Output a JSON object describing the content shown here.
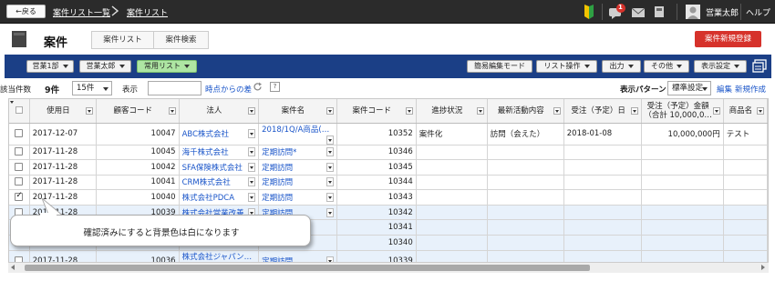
{
  "topbar": {
    "back_label": "←戻る",
    "crumb1": "案件リスト一覧",
    "crumb2": "案件リスト",
    "notification_count": "1",
    "user_name": "営業太郎",
    "help_label": "ヘルプ"
  },
  "title": {
    "page_title": "案件",
    "tab_list": "案件リスト",
    "tab_search": "案件検索",
    "new_button": "案件新規登録"
  },
  "toolbar": {
    "dept": "営業1部",
    "person": "営業太郎",
    "common_list": "常用リスト",
    "easy_edit": "簡易編集モード",
    "list_ops": "リスト操作",
    "output": "出力",
    "other": "その他",
    "display_settings": "表示設定"
  },
  "filter": {
    "count_label": "該当件数",
    "count_value": "9件",
    "per_page": "15件",
    "display_label": "表示",
    "diff_link": "時点からの差",
    "help_q": "?",
    "pattern_label": "表示パターン",
    "pattern_value": "標準設定",
    "edit_link": "編集",
    "new_link": "新規作成"
  },
  "columns": [
    "使用日",
    "顧客コード",
    "法人",
    "案件名",
    "案件コード",
    "進捗状況",
    "最新活動内容",
    "受注（予定）日",
    "受注（予定）金額\n（合計 10,000,0…",
    "商品名"
  ],
  "rows": [
    {
      "checked": false,
      "confirmed": true,
      "date": "2017-12-07",
      "cust_code": "10047",
      "corp": "ABC株式会社",
      "deal": "2018/1Q/A商品(…",
      "deal_code": "10352",
      "progress": "案件化",
      "activity": "訪問（会えた）",
      "order_date": "2018-01-08",
      "amount": "10,000,000円",
      "product": "テスト"
    },
    {
      "checked": false,
      "confirmed": true,
      "date": "2017-11-28",
      "cust_code": "10045",
      "corp": "海千株式会社",
      "deal": "定期訪問*",
      "deal_code": "10346",
      "progress": "",
      "activity": "",
      "order_date": "",
      "amount": "",
      "product": ""
    },
    {
      "checked": false,
      "confirmed": true,
      "date": "2017-11-28",
      "cust_code": "10042",
      "corp": "SFA保険株式会社",
      "deal": "定期訪問",
      "deal_code": "10345",
      "progress": "",
      "activity": "",
      "order_date": "",
      "amount": "",
      "product": ""
    },
    {
      "checked": false,
      "confirmed": true,
      "date": "2017-11-28",
      "cust_code": "10041",
      "corp": "CRM株式会社",
      "deal": "定期訪問",
      "deal_code": "10344",
      "progress": "",
      "activity": "",
      "order_date": "",
      "amount": "",
      "product": ""
    },
    {
      "checked": true,
      "confirmed": true,
      "date": "2017-11-28",
      "cust_code": "10040",
      "corp": "株式会社PDCA",
      "deal": "定期訪問",
      "deal_code": "10343",
      "progress": "",
      "activity": "",
      "order_date": "",
      "amount": "",
      "product": ""
    },
    {
      "checked": false,
      "confirmed": false,
      "date": "2017-11-28",
      "cust_code": "10039",
      "corp": "株式会社営業改善",
      "deal": "定期訪問",
      "deal_code": "10342",
      "progress": "",
      "activity": "",
      "order_date": "",
      "amount": "",
      "product": ""
    },
    {
      "checked": false,
      "confirmed": false,
      "date": "",
      "cust_code": "",
      "corp": "",
      "deal": "",
      "deal_code": "10341",
      "progress": "",
      "activity": "",
      "order_date": "",
      "amount": "",
      "product": ""
    },
    {
      "checked": false,
      "confirmed": false,
      "date": "",
      "cust_code": "",
      "corp": "",
      "deal": "",
      "deal_code": "10340",
      "progress": "",
      "activity": "",
      "order_date": "",
      "amount": "",
      "product": ""
    },
    {
      "checked": false,
      "confirmed": false,
      "date": "2017-11-28",
      "cust_code": "10036",
      "corp": "株式会社ジャパン…",
      "deal": "定期訪問",
      "deal_code": "10339",
      "progress": "",
      "activity": "",
      "order_date": "",
      "amount": "",
      "product": ""
    }
  ],
  "callout": {
    "text": "確認済みにすると背景色は白になります"
  },
  "colors": {
    "topbar": "#2b2b2b",
    "toolbar": "#1b3f86",
    "accent_red": "#d6322b",
    "unconfirmed_row": "#e8f1fb",
    "link": "#1a55c9"
  }
}
